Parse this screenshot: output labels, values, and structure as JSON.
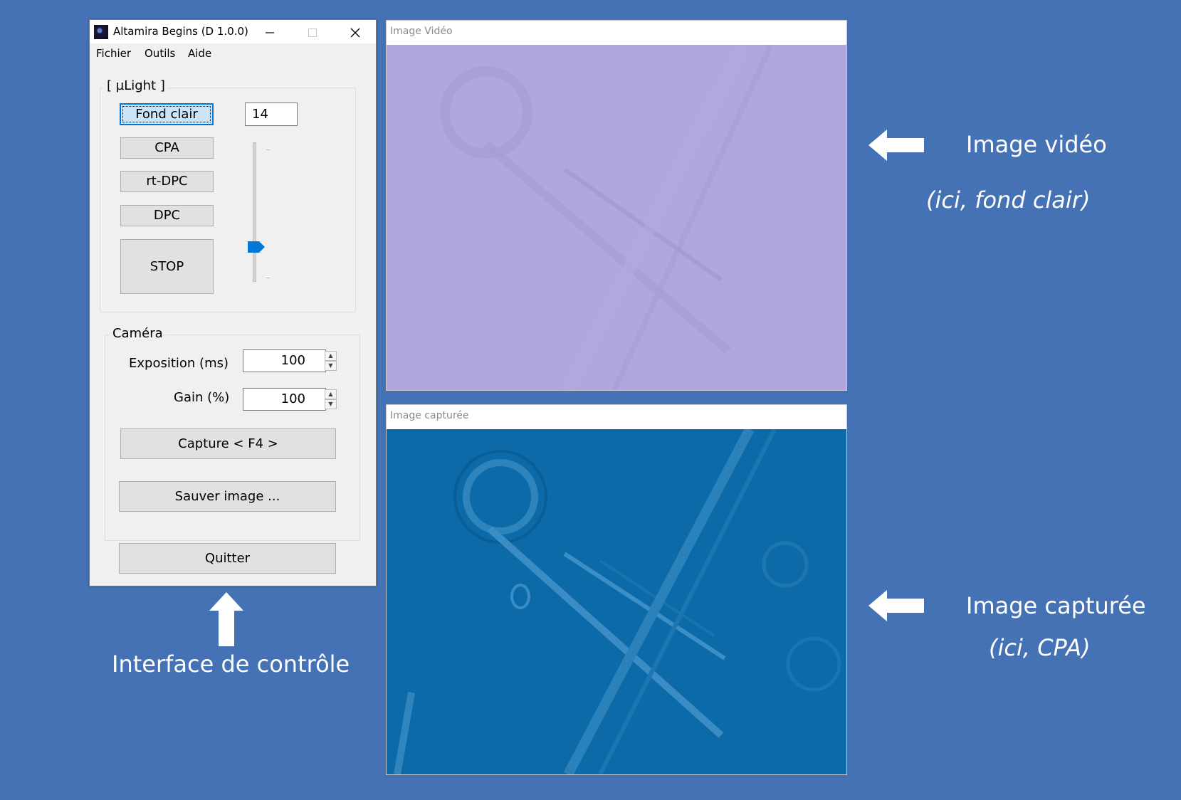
{
  "window": {
    "title": "Altamira Begins (D 1.0.0)",
    "minimize_icon": "minimize-icon",
    "maximize_icon": "maximize-icon",
    "close_icon": "close-icon"
  },
  "menu": {
    "items": [
      {
        "label": "Fichier"
      },
      {
        "label": "Outils"
      },
      {
        "label": "Aide"
      }
    ]
  },
  "ulight": {
    "group_label": "[ µLight ]",
    "buttons": [
      {
        "label": "Fond clair",
        "active": true
      },
      {
        "label": "CPA"
      },
      {
        "label": "rt-DPC"
      },
      {
        "label": "DPC"
      },
      {
        "label": "STOP"
      }
    ],
    "intensity_value": "14",
    "slider_level_fraction": 0.14
  },
  "camera": {
    "group_label": "Caméra",
    "exposure_label": "Exposition (ms)",
    "exposure_value": "100",
    "gain_label": "Gain (%)",
    "gain_value": "100",
    "capture_label": "Capture < F4 >",
    "save_label": "Sauver image ..."
  },
  "quit_label": "Quitter",
  "viewers": {
    "video_title": "Image Vidéo",
    "captured_title": "Image capturée",
    "video_color": "#afa7de",
    "captured_color": "#0d6aa8"
  },
  "annotations": {
    "video_label": "Image vidéo",
    "video_sub": "(ici, fond clair)",
    "captured_label": "Image capturée",
    "captured_sub": "(ici, CPA)",
    "interface_label": "Interface de contrôle"
  },
  "colors": {
    "background": "#4472b5",
    "accent": "#0078d7"
  }
}
